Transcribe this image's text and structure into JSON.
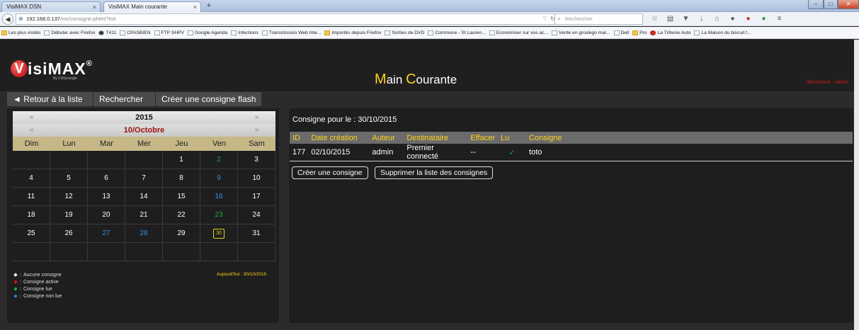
{
  "browser": {
    "tabs": [
      {
        "label": "VisiMAX DSN"
      },
      {
        "label": "VisiMAX Main courante"
      }
    ],
    "new_tab": "+",
    "url_host": "192.168.0.137",
    "url_path": "/mc/consigne.phtml?init",
    "search_placeholder": "Rechercher",
    "bookmarks": [
      {
        "label": "Les plus visités",
        "icon": "folder"
      },
      {
        "label": "Débuter avec Firefox",
        "icon": "page"
      },
      {
        "label": "T411",
        "icon": "eye"
      },
      {
        "label": "CPASBIEN",
        "icon": "page"
      },
      {
        "label": "FTP SHPV",
        "icon": "page"
      },
      {
        "label": "Google Agenda",
        "icon": "page"
      },
      {
        "label": "Infections",
        "icon": "page"
      },
      {
        "label": "Transmission Web Inte...",
        "icon": "page"
      },
      {
        "label": "Importés depuis Firefox",
        "icon": "folder"
      },
      {
        "label": "Sorties de DVD",
        "icon": "page"
      },
      {
        "label": "Commune - St Lauren...",
        "icon": "page"
      },
      {
        "label": "Economiser sur vos ac...",
        "icon": "page"
      },
      {
        "label": "Vente en groslego mar...",
        "icon": "page"
      },
      {
        "label": "Dell",
        "icon": "page"
      },
      {
        "label": "Pro",
        "icon": "folder"
      },
      {
        "label": "La Tribune Auto",
        "icon": "red"
      },
      {
        "label": "La Maison du biscuit f...",
        "icon": "page"
      }
    ]
  },
  "app": {
    "logo_text": "isiMAX",
    "logo_letter": "V",
    "logo_reg": "®",
    "logo_sub": "By CASynergie",
    "title_cap1": "M",
    "title_rest1": "ain ",
    "title_cap2": "C",
    "title_rest2": "ourante",
    "welcome": "Bienvenue : admin"
  },
  "toolbar": {
    "back_label": "◄ Retour à la liste",
    "search_label": "Rechercher",
    "flash_label": "Créer une consigne flash"
  },
  "calendar": {
    "prev": "«",
    "next": "»",
    "year": "2015",
    "month": "10/Octobre",
    "days": [
      "Dim",
      "Lun",
      "Mar",
      "Mer",
      "Jeu",
      "Ven",
      "Sam"
    ],
    "weeks": [
      [
        {
          "d": ""
        },
        {
          "d": ""
        },
        {
          "d": ""
        },
        {
          "d": ""
        },
        {
          "d": "1"
        },
        {
          "d": "2",
          "c": "green"
        },
        {
          "d": "3"
        }
      ],
      [
        {
          "d": "4"
        },
        {
          "d": "5"
        },
        {
          "d": "6"
        },
        {
          "d": "7"
        },
        {
          "d": "8"
        },
        {
          "d": "9",
          "c": "blue"
        },
        {
          "d": "10"
        }
      ],
      [
        {
          "d": "11"
        },
        {
          "d": "12"
        },
        {
          "d": "13"
        },
        {
          "d": "14"
        },
        {
          "d": "15"
        },
        {
          "d": "16",
          "c": "blue"
        },
        {
          "d": "17"
        }
      ],
      [
        {
          "d": "18"
        },
        {
          "d": "19"
        },
        {
          "d": "20"
        },
        {
          "d": "21"
        },
        {
          "d": "22"
        },
        {
          "d": "23",
          "c": "green"
        },
        {
          "d": "24"
        }
      ],
      [
        {
          "d": "25"
        },
        {
          "d": "26"
        },
        {
          "d": "27",
          "c": "blue"
        },
        {
          "d": "28",
          "c": "blue"
        },
        {
          "d": "29"
        },
        {
          "d": "30",
          "today": true
        },
        {
          "d": "31"
        }
      ],
      [
        {
          "d": ""
        },
        {
          "d": ""
        },
        {
          "d": ""
        },
        {
          "d": ""
        },
        {
          "d": ""
        },
        {
          "d": ""
        },
        {
          "d": ""
        }
      ]
    ],
    "legend": [
      {
        "label": "Aucune consigne",
        "color": "#ffffff"
      },
      {
        "label": "Consigne active",
        "color": "#d21818"
      },
      {
        "label": "Consigne lue",
        "color": "#1fa83a"
      },
      {
        "label": "Consigne non lue",
        "color": "#2f7fd3"
      }
    ],
    "legend_sep": ":",
    "today_note": "Aujourd'hui : 30/10/2015"
  },
  "consignes": {
    "date_label": "Consigne pour le : 30/10/2015",
    "columns": [
      "ID",
      "Date création",
      "Auteur",
      "Destinataire",
      "Effacer",
      "Lu",
      "Consigne"
    ],
    "rows": [
      {
        "id": "177",
        "date": "02/10/2015",
        "auteur": "admin",
        "destinataire": "Premier connecté",
        "effacer": "--",
        "lu": "✓",
        "consigne": "toto"
      }
    ],
    "create_label": "Créer une consigne",
    "delete_label": "Supprimer la liste des consignes"
  },
  "colors": {
    "accent_yellow": "#ffd21a",
    "brand_red": "#d21818",
    "read_green": "#1fa83a",
    "unread_blue": "#2f7fd3"
  }
}
